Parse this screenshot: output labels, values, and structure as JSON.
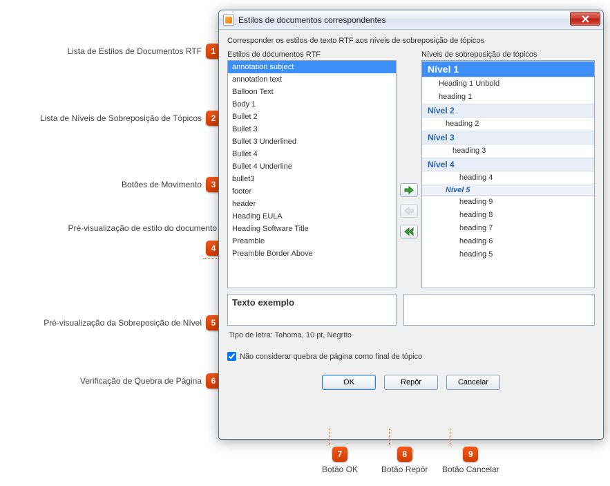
{
  "window": {
    "title": "Estilos de documentos correspondentes",
    "intro": "Corresponder os estilos de texto RTF aos níveis de sobreposição de tópicos",
    "left_label": "Estilos de documentos RTF",
    "right_label": "Níveis de sobreposição de tópicos"
  },
  "rtf_styles": [
    "annotation subject",
    "annotation text",
    "Balloon Text",
    "Body 1",
    "Bullet 2",
    "Bullet 3",
    "Bullet 3 Underlined",
    "Bullet 4",
    "Bullet 4 Underline",
    "bullet3",
    "footer",
    "header",
    "Heading EULA",
    "Heading Software Title",
    "Preamble",
    "Preamble Border Above"
  ],
  "rtf_selected_index": 0,
  "levels": [
    {
      "header": "Nível 1",
      "big": true,
      "items": [
        "Heading 1 Unbold",
        "heading 1"
      ]
    },
    {
      "header": "Nível 2",
      "items": [
        "heading 2"
      ]
    },
    {
      "header": "Nível 3",
      "items": [
        "heading 3"
      ]
    },
    {
      "header": "Nível 4",
      "items": [
        "heading 4"
      ]
    },
    {
      "header": "Nível 5",
      "sub": true,
      "items": [
        "heading 9",
        "heading 8",
        "heading 7",
        "heading 6",
        "heading 5"
      ]
    }
  ],
  "preview_text": "Texto exemplo",
  "font_line": "Tipo de letra: Tahoma, 10 pt, Negrito",
  "checkbox": {
    "label": "Não considerar quebra de página como final de tópico",
    "checked": true
  },
  "buttons": {
    "ok": "OK",
    "reset": "Repôr",
    "cancel": "Cancelar"
  },
  "callouts": {
    "c1": "Lista de Estilos de Documentos RTF",
    "c2": "Lista de Níveis de Sobreposição de Tópicos",
    "c3": "Botões de Movimento",
    "c4": "Pré-visualização de estilo do documento",
    "c5": "Pré-visualização da Sobreposição de Nível",
    "c6": "Verificação de Quebra de Página",
    "c7": "Botão OK",
    "c8": "Botão Repôr",
    "c9": "Botão Cancelar",
    "n1": "1",
    "n2": "2",
    "n3": "3",
    "n4": "4",
    "n5": "5",
    "n6": "6",
    "n7": "7",
    "n8": "8",
    "n9": "9"
  }
}
